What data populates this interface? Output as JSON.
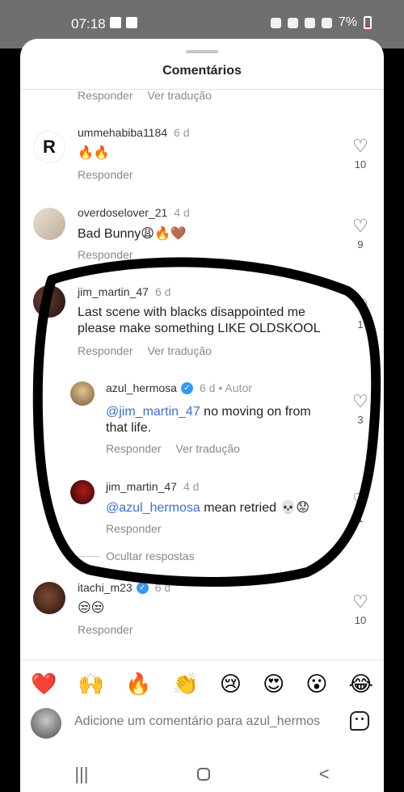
{
  "status_bar": {
    "time": "07:18",
    "battery": "7%"
  },
  "sheet": {
    "title": "Comentários"
  },
  "top_actions": {
    "reply": "Responder",
    "translate": "Ver tradução"
  },
  "comments": [
    {
      "username": "ummehabiba1184",
      "time": "6 d",
      "text": "🔥🔥",
      "reply": "Responder",
      "likes": "10",
      "avatar_letter": "R"
    },
    {
      "username": "overdoselover_21",
      "time": "4 d",
      "text": "Bad Bunny😩🔥🤎",
      "reply": "Responder",
      "likes": "9"
    },
    {
      "username": "jim_martin_47",
      "time": "6 d",
      "text": "Last scene with blacks disappointed me please make something LIKE OLDSKOOL",
      "reply": "Responder",
      "translate": "Ver tradução",
      "likes": "1"
    }
  ],
  "replies": [
    {
      "username": "azul_hermosa",
      "time": "6 d",
      "author": "• Autor",
      "mention": "@jim_martin_47",
      "text": " no moving on from that life.",
      "reply": "Responder",
      "translate": "Ver tradução",
      "likes": "3"
    },
    {
      "username": "jim_martin_47",
      "time": "4 d",
      "mention": "@azul_hermosa",
      "text": " mean retried 💀😟",
      "reply": "Responder",
      "likes": "1"
    }
  ],
  "hide_replies": "Ocultar respostas",
  "last_comment": {
    "username": "itachi_m23",
    "time": "6 d",
    "text": "😒😒",
    "reply": "Responder",
    "likes": "10"
  },
  "emoji_bar": [
    "❤️",
    "🙌",
    "🔥",
    "👏",
    "😢",
    "😍",
    "😮",
    "😂"
  ],
  "composer": {
    "placeholder": "Adicione um comentário para azul_hermos"
  },
  "nav": {
    "recents": "|||",
    "back": "<"
  },
  "colors": {
    "mention": "#3a6fd8",
    "verified": "#3897f0"
  }
}
